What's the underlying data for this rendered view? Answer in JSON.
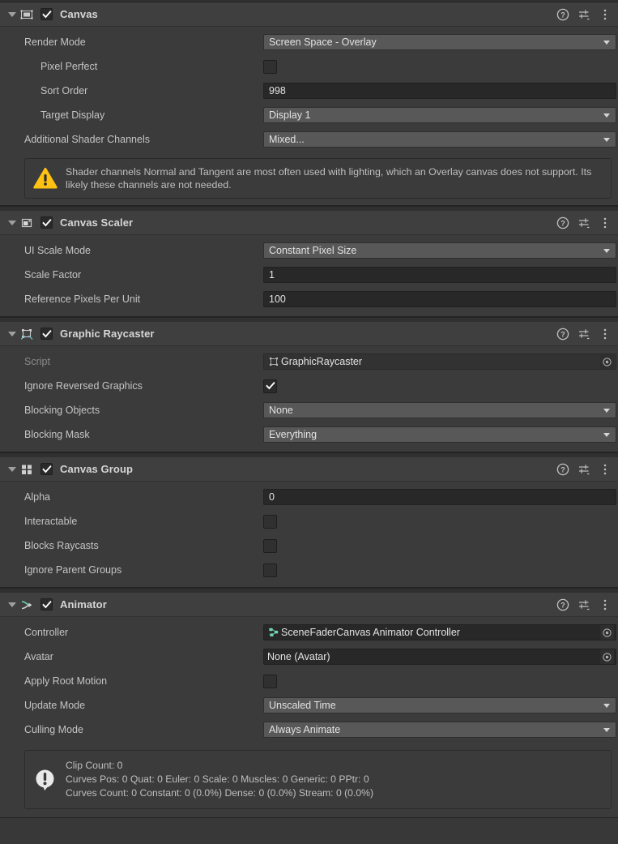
{
  "components": [
    {
      "id": "canvas",
      "title": "Canvas",
      "icon": "canvas-icon",
      "enabled": true,
      "expanded": true,
      "tools": [
        "help-icon",
        "settings-preset-icon",
        "more-menu-icon"
      ],
      "rows": [
        {
          "label": "Render Mode",
          "type": "popup",
          "value": "Screen Space - Overlay",
          "indent": false
        },
        {
          "label": "Pixel Perfect",
          "type": "checkbox",
          "value": false,
          "indent": true
        },
        {
          "label": "Sort Order",
          "type": "text",
          "value": "998",
          "indent": true
        },
        {
          "label": "Target Display",
          "type": "popup",
          "value": "Display 1",
          "indent": true
        },
        {
          "label": "Additional Shader Channels",
          "type": "popup",
          "value": "Mixed...",
          "indent": false
        }
      ],
      "helpbox": {
        "kind": "warning",
        "text": "Shader channels Normal and Tangent are most often used with lighting, which an Overlay canvas does not support. Its likely these channels are not needed."
      }
    },
    {
      "id": "canvas-scaler",
      "title": "Canvas Scaler",
      "icon": "canvas-scaler-icon",
      "enabled": true,
      "expanded": true,
      "tools": [
        "help-icon",
        "settings-preset-icon",
        "more-menu-icon"
      ],
      "rows": [
        {
          "label": "UI Scale Mode",
          "type": "popup",
          "value": "Constant Pixel Size",
          "indent": false
        },
        {
          "label": "Scale Factor",
          "type": "text",
          "value": "1",
          "indent": false
        },
        {
          "label": "Reference Pixels Per Unit",
          "type": "text",
          "value": "100",
          "indent": false
        }
      ]
    },
    {
      "id": "graphic-raycaster",
      "title": "Graphic Raycaster",
      "icon": "graphic-raycaster-icon",
      "enabled": true,
      "expanded": true,
      "tools": [
        "help-icon",
        "settings-preset-icon",
        "more-menu-icon"
      ],
      "rows": [
        {
          "label": "Script",
          "type": "object-dim",
          "value": "GraphicRaycaster",
          "objicon": "script-icon",
          "indent": false
        },
        {
          "label": "Ignore Reversed Graphics",
          "type": "checkbox",
          "value": true,
          "indent": false
        },
        {
          "label": "Blocking Objects",
          "type": "popup",
          "value": "None",
          "indent": false
        },
        {
          "label": "Blocking Mask",
          "type": "popup",
          "value": "Everything",
          "indent": false
        }
      ]
    },
    {
      "id": "canvas-group",
      "title": "Canvas Group",
      "icon": "canvas-group-icon",
      "enabled": true,
      "expanded": true,
      "tools": [
        "help-icon",
        "settings-preset-icon",
        "more-menu-icon"
      ],
      "rows": [
        {
          "label": "Alpha",
          "type": "text",
          "value": "0",
          "indent": false
        },
        {
          "label": "Interactable",
          "type": "checkbox",
          "value": false,
          "indent": false
        },
        {
          "label": "Blocks Raycasts",
          "type": "checkbox",
          "value": false,
          "indent": false
        },
        {
          "label": "Ignore Parent Groups",
          "type": "checkbox",
          "value": false,
          "indent": false
        }
      ]
    },
    {
      "id": "animator",
      "title": "Animator",
      "icon": "animator-icon",
      "enabled": true,
      "expanded": true,
      "tools": [
        "help-icon",
        "settings-preset-icon",
        "more-menu-icon"
      ],
      "rows": [
        {
          "label": "Controller",
          "type": "object",
          "value": "SceneFaderCanvas Animator Controller",
          "objicon": "animator-controller-icon",
          "indent": false
        },
        {
          "label": "Avatar",
          "type": "object",
          "value": "None (Avatar)",
          "objicon": "none",
          "indent": false
        },
        {
          "label": "Apply Root Motion",
          "type": "checkbox",
          "value": false,
          "indent": false
        },
        {
          "label": "Update Mode",
          "type": "popup",
          "value": "Unscaled Time",
          "indent": false
        },
        {
          "label": "Culling Mode",
          "type": "popup",
          "value": "Always Animate",
          "indent": false
        }
      ],
      "helpbox": {
        "kind": "info",
        "text": "Clip Count: 0\nCurves Pos: 0 Quat: 0 Euler: 0 Scale: 0 Muscles: 0 Generic: 0 PPtr: 0\nCurves Count: 0 Constant: 0 (0.0%) Dense: 0 (0.0%) Stream: 0 (0.0%)"
      }
    }
  ],
  "colors": {
    "panel_bg": "#383838",
    "component_bg": "#3b3b3b",
    "header_bg": "#3f3f3f",
    "popup_bg": "#585858",
    "textfield_bg": "#282828",
    "warning_yellow": "#FFC107",
    "info_white": "#e8e8e8",
    "accent_teal": "#72d6b9",
    "accent_blue": "#6fc3df",
    "text": "#c4c4c4"
  }
}
